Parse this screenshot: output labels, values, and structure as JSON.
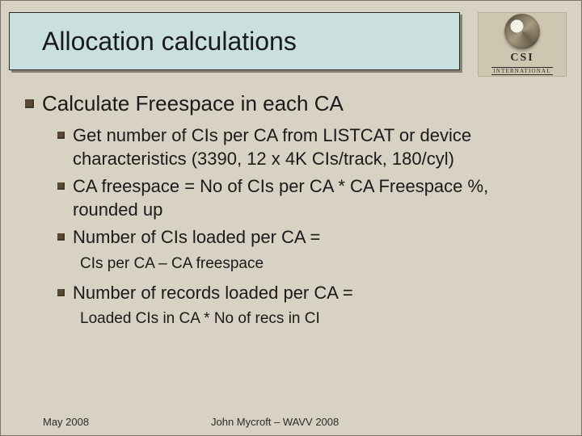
{
  "title": "Allocation calculations",
  "logo": {
    "main": "CSI",
    "sub": "INTERNATIONAL"
  },
  "bullets": {
    "lvl1_0": "Calculate Freespace in each CA",
    "lvl2_0": "Get number of CIs per CA from LISTCAT or device characteristics (3390, 12 x 4K CIs/track, 180/cyl)",
    "lvl2_1": "CA freespace = No of CIs per CA * CA Freespace %, rounded up",
    "lvl2_2": "Number of CIs loaded per CA =",
    "lvl3_0": "CIs per CA – CA freespace",
    "lvl2_3": "Number of records loaded per CA =",
    "lvl3_1": "Loaded CIs in CA * No  of recs in CI"
  },
  "footer": {
    "date": "May 2008",
    "author": "John Mycroft – WAVV 2008"
  }
}
